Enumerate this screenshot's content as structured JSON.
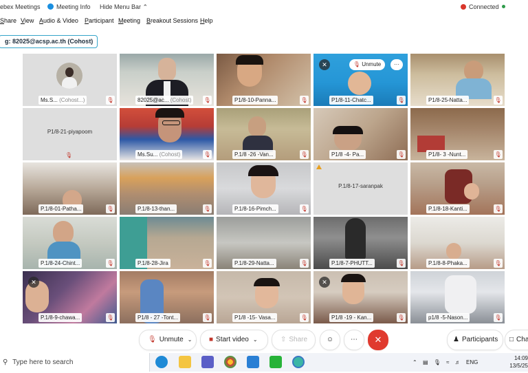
{
  "topbar": {
    "app_title": "ebex Meetings",
    "meeting_info": "Meeting Info",
    "hide_menu": "Hide Menu Bar",
    "connection": "Connected"
  },
  "menu": [
    "Share",
    "View",
    "Audio & Video",
    "Participant",
    "Meeting",
    "Breakout Sessions",
    "Help"
  ],
  "speaker": "g: 82025@acsp.ac.th (Cohost)",
  "tiles": [
    {
      "name": "Ms.S...",
      "role": "(Cohost...)"
    },
    {
      "name": "82025@ac...",
      "role": "(Cohost)"
    },
    {
      "name": "P1/8-10-Panna...",
      "role": ""
    },
    {
      "name": "P1/8-11-Chatc...",
      "role": ""
    },
    {
      "name": "P1/8-25-Natta...",
      "role": ""
    },
    {
      "name": "P1/8-21-piyapoom",
      "role": ""
    },
    {
      "name": "Ms.Su...",
      "role": "(Cohost)"
    },
    {
      "name": "P.1/8 -26 -Van...",
      "role": ""
    },
    {
      "name": "P1/8 -4- Pa...",
      "role": ""
    },
    {
      "name": "P1/8- 3 -Nunt...",
      "role": ""
    },
    {
      "name": "P.1/8-01-Patha...",
      "role": ""
    },
    {
      "name": "P.1/8-13-than...",
      "role": ""
    },
    {
      "name": "P.1/8-16-Pimch...",
      "role": ""
    },
    {
      "name": "P.1/8-17-saranpak",
      "role": ""
    },
    {
      "name": "P.1/8-18-Kanti...",
      "role": ""
    },
    {
      "name": "P.1/8-24-Chint...",
      "role": ""
    },
    {
      "name": "P.1/8-28-Jira",
      "role": ""
    },
    {
      "name": "P.1/8-29-Natta...",
      "role": ""
    },
    {
      "name": "P.1/8-7-PHUTT...",
      "role": ""
    },
    {
      "name": "P.1/8-8-Phaka...",
      "role": ""
    },
    {
      "name": "P.1/8-9-chawa...",
      "role": ""
    },
    {
      "name": "P1/8 - 27 -Tont...",
      "role": ""
    },
    {
      "name": "P1/8 -15- Vasa...",
      "role": ""
    },
    {
      "name": "P1/8 -19 - Kan...",
      "role": ""
    },
    {
      "name": "p1/8 -5-Nason...",
      "role": ""
    }
  ],
  "hover": {
    "unmute": "Unmute",
    "more": "···"
  },
  "controls": {
    "unmute": "Unmute",
    "start_video": "Start video",
    "share": "Share",
    "participants": "Participants",
    "chat": "Cha"
  },
  "taskbar": {
    "search_placeholder": "Type here to search",
    "lang": "ENG",
    "time": "14:09",
    "date": "13/5/25"
  },
  "colors": {
    "accent": "#2ea9de",
    "mute_red": "#c2362b",
    "end_red": "#e03a2f"
  }
}
